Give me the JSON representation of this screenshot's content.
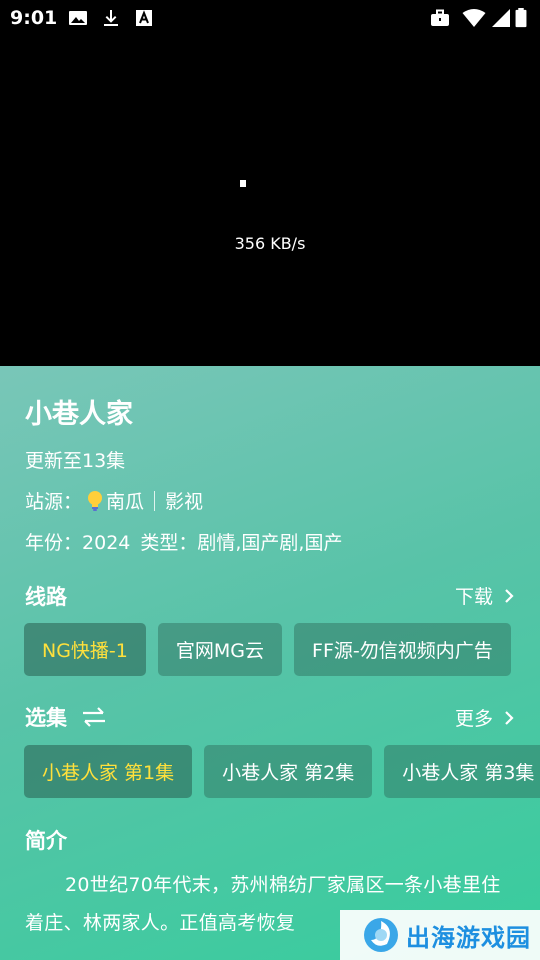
{
  "status_bar": {
    "time": "9:01",
    "left_icons": [
      "image-icon",
      "download-icon",
      "text-a-icon"
    ],
    "right_icons": [
      "briefcase-icon",
      "wifi-icon",
      "signal-icon",
      "battery-icon"
    ]
  },
  "player": {
    "speed": "356 KB/s"
  },
  "detail": {
    "title": "小巷人家",
    "update": "更新至13集",
    "source_label": "站源：",
    "source_name": "南瓜",
    "source_extra": "影视",
    "year_label": "年份：",
    "year": "2024",
    "type_label": "类型：",
    "type": "剧情,国产剧,国产"
  },
  "routes": {
    "title": "线路",
    "download_label": "下载",
    "items": [
      {
        "label": "NG快播-1",
        "active": true
      },
      {
        "label": "官网MG云",
        "active": false
      },
      {
        "label": "FF源-勿信视频内广告",
        "active": false
      }
    ]
  },
  "episodes": {
    "title": "选集",
    "more_label": "更多",
    "items": [
      {
        "label": "小巷人家 第1集",
        "active": true
      },
      {
        "label": "小巷人家 第2集",
        "active": false
      },
      {
        "label": "小巷人家 第3集",
        "active": false
      }
    ]
  },
  "intro": {
    "title": "简介",
    "text": "20世纪70年代末，苏州棉纺厂家属区一条小巷里住着庄、林两家人。正值高考恢复"
  },
  "watermark": {
    "text": "出海游戏园"
  },
  "colors": {
    "accent_active": "#ffe03c",
    "panel_start": "#79c6b8",
    "panel_end": "#37cd9d"
  }
}
